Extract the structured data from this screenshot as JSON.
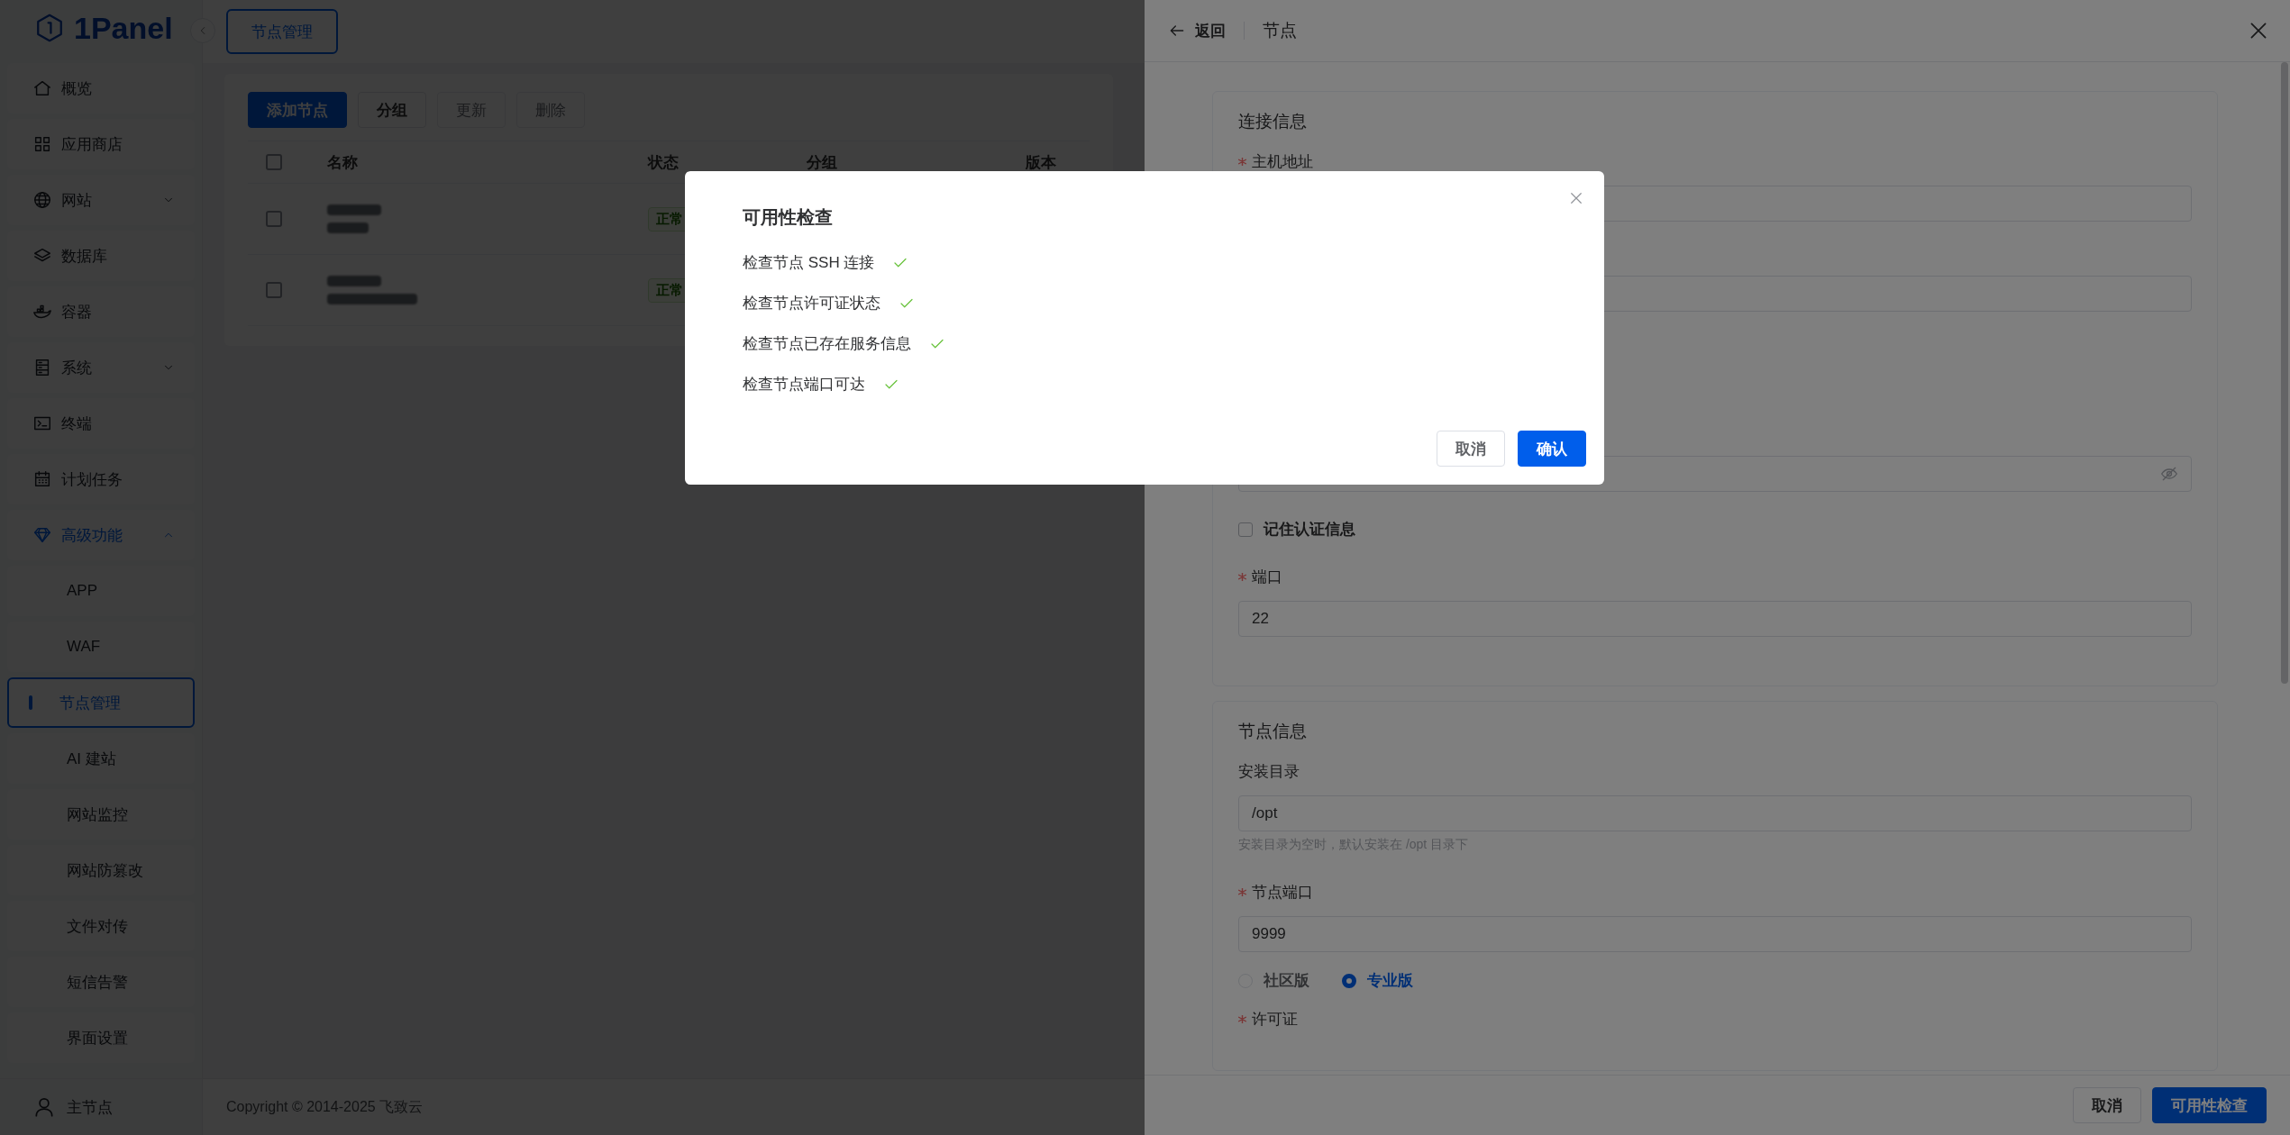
{
  "sidebar": {
    "logo": "1Panel",
    "items": [
      {
        "label": "概览",
        "selected": false
      },
      {
        "label": "应用商店",
        "selected": false
      },
      {
        "label": "网站",
        "selected": false,
        "expanded": false
      },
      {
        "label": "数据库",
        "selected": false
      },
      {
        "label": "容器",
        "selected": false
      },
      {
        "label": "系统",
        "selected": false,
        "expanded": false
      },
      {
        "label": "终端",
        "selected": false
      },
      {
        "label": "计划任务",
        "selected": false
      },
      {
        "label": "高级功能",
        "selected": false,
        "expanded": true,
        "children": [
          {
            "label": "APP",
            "selected": false
          },
          {
            "label": "WAF",
            "selected": false
          },
          {
            "label": "节点管理",
            "selected": true
          },
          {
            "label": "AI 建站",
            "selected": false
          },
          {
            "label": "网站监控",
            "selected": false
          },
          {
            "label": "网站防篡改",
            "selected": false
          },
          {
            "label": "文件对传",
            "selected": false
          },
          {
            "label": "短信告警",
            "selected": false
          },
          {
            "label": "界面设置",
            "selected": false
          }
        ]
      }
    ],
    "footer": "主节点"
  },
  "header": {
    "tab": "节点管理"
  },
  "toolbar": [
    {
      "label": "添加节点",
      "kind": "primary",
      "disabled": false
    },
    {
      "label": "分组",
      "kind": "default",
      "disabled": false
    },
    {
      "label": "更新",
      "kind": "default",
      "disabled": true
    },
    {
      "label": "删除",
      "kind": "default",
      "disabled": true
    }
  ],
  "table": {
    "select_all_checked": false,
    "columns": [
      "名称",
      "状态",
      "分组",
      "版本"
    ],
    "rows": [
      {
        "checked": false,
        "status": "正常"
      },
      {
        "checked": false,
        "status": "正常"
      }
    ]
  },
  "copyright": "Copyright © 2014-2025 飞致云",
  "drawer": {
    "back": "返回",
    "title": "节点",
    "sections": [
      {
        "title": "连接信息",
        "fields": [
          {
            "kind": "input",
            "label": "主机地址",
            "required": true
          },
          {
            "kind": "input"
          },
          {
            "kind": "password"
          },
          {
            "kind": "checkbox",
            "label": "记住认证信息",
            "checked": false
          },
          {
            "kind": "input",
            "label": "端口",
            "required": true,
            "value": "22"
          }
        ]
      },
      {
        "title": "节点信息",
        "fields": [
          {
            "kind": "input",
            "label": "安装目录",
            "required": false,
            "value": "/opt",
            "hint": "安装目录为空时，默认安装在 /opt 目录下"
          },
          {
            "kind": "input",
            "label": "节点端口",
            "required": true,
            "value": "9999"
          },
          {
            "kind": "radio",
            "options": [
              {
                "label": "社区版",
                "selected": false
              },
              {
                "label": "专业版",
                "selected": true
              }
            ]
          },
          {
            "kind": "label",
            "label": "许可证",
            "required": true
          }
        ]
      }
    ],
    "buttons": [
      {
        "label": "取消",
        "kind": "default"
      },
      {
        "label": "可用性检查",
        "kind": "primary"
      }
    ]
  },
  "dialog": {
    "title": "可用性检查",
    "checks": [
      {
        "label": "检查节点 SSH 连接",
        "passed": true
      },
      {
        "label": "检查节点许可证状态",
        "passed": true
      },
      {
        "label": "检查节点已存在服务信息",
        "passed": true
      },
      {
        "label": "检查节点端口可达",
        "passed": true
      }
    ],
    "buttons": [
      {
        "label": "取消",
        "kind": "default"
      },
      {
        "label": "确认",
        "kind": "primary"
      }
    ]
  }
}
